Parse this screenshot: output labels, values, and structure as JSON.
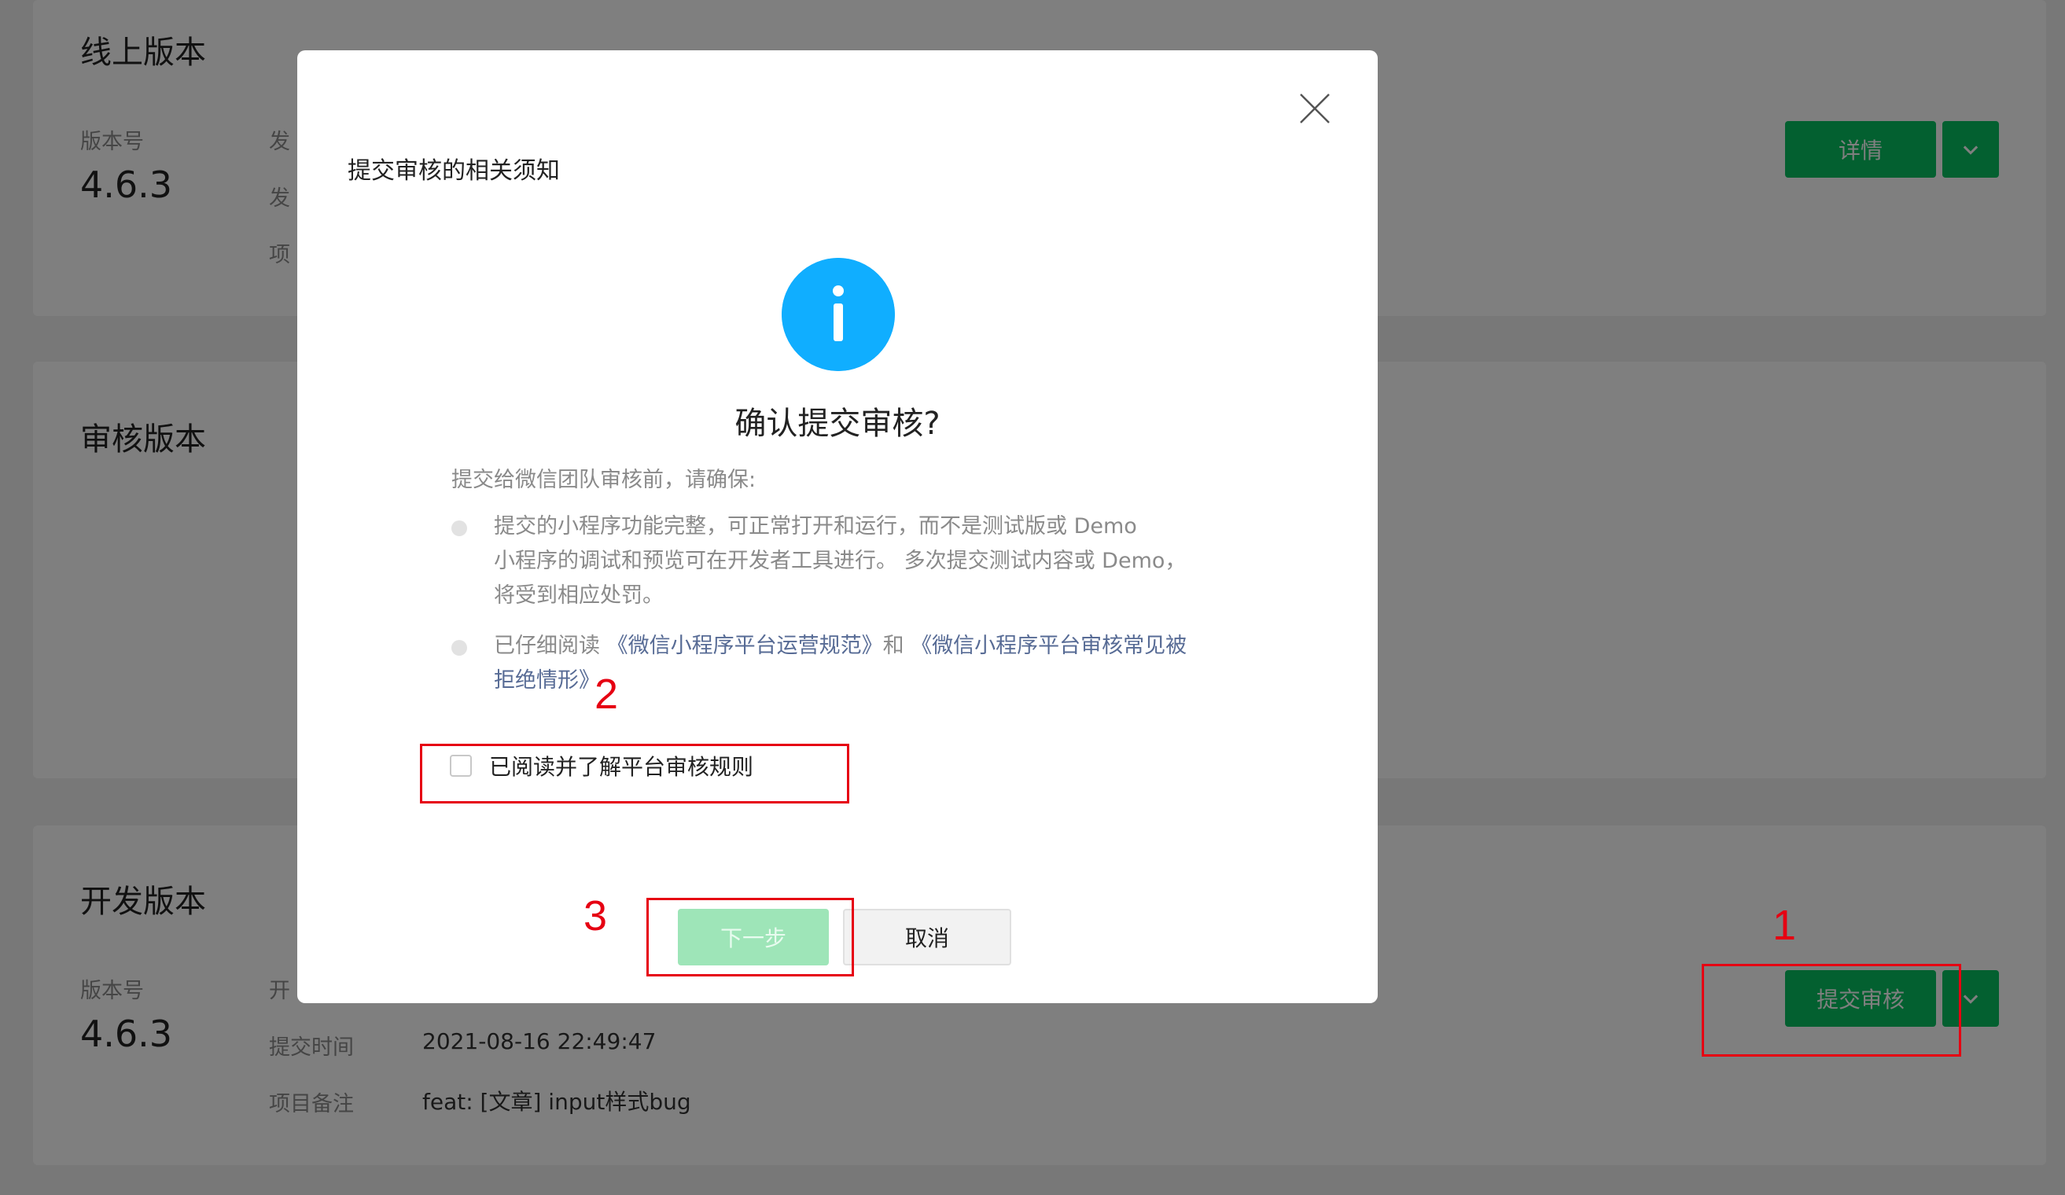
{
  "page": {
    "online": {
      "title": "线上版本",
      "version_label": "版本号",
      "version": "4.6.3",
      "meta_labels": [
        "发",
        "发",
        "项"
      ],
      "detail_button": "详情"
    },
    "review": {
      "title": "审核版本"
    },
    "dev": {
      "title": "开发版本",
      "version_label": "版本号",
      "version": "4.6.3",
      "meta_label_partial": "开",
      "submit_time_label": "提交时间",
      "submit_time": "2021-08-16 22:49:47",
      "remark_label": "项目备注",
      "remark": "feat: [文章] input样式bug",
      "submit_button": "提交审核"
    }
  },
  "dialog": {
    "title": "提交审核的相关须知",
    "heading": "确认提交审核?",
    "intro": "提交给微信团队审核前，请确保:",
    "bullet1": {
      "line1": "提交的小程序功能完整，可正常打开和运行，而不是测试版或 Demo",
      "line2": "小程序的调试和预览可在开发者工具进行。 多次提交测试内容或 Demo，",
      "line3": "将受到相应处罚。"
    },
    "bullet2": {
      "prefix": "已仔细阅读 ",
      "link1": "《微信小程序平台运营规范》",
      "middle": "和 ",
      "link2_line1": "《微信小程序平台审核常见被",
      "link2_line2": "拒绝情形》"
    },
    "checkbox_label": "已阅读并了解平台审核规则",
    "next_button": "下一步",
    "cancel_button": "取消"
  },
  "annotations": {
    "num1": "1",
    "num2": "2",
    "num3": "3",
    "color": "#e60012"
  },
  "colors": {
    "brand_green": "#07c160",
    "disabled_green": "#9ee5b8",
    "info_blue": "#10aeff",
    "link_blue": "#576b95"
  },
  "icons": {
    "close": "close-icon",
    "info": "info-icon",
    "dropdown": "chevron-down-icon"
  }
}
